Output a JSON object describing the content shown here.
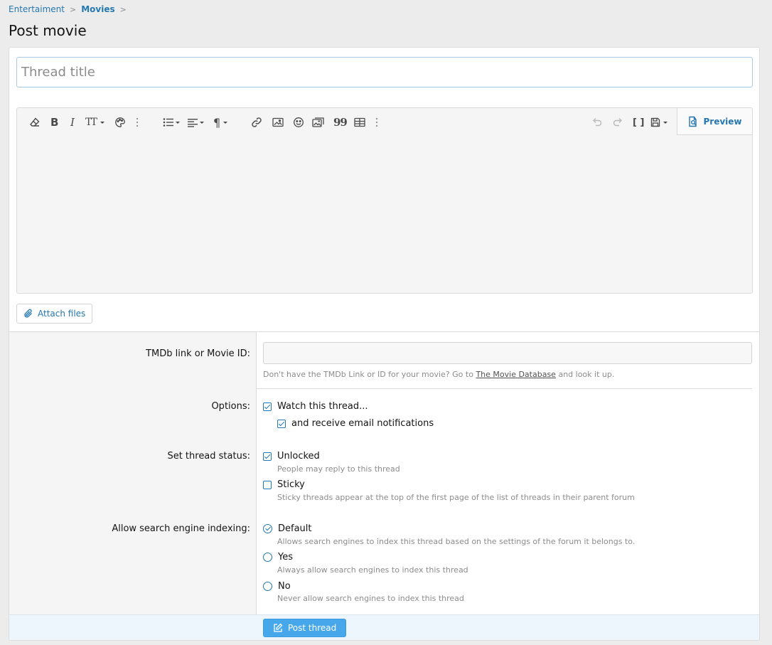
{
  "breadcrumb": {
    "items": [
      {
        "label": "Entertaiment",
        "bold": false
      },
      {
        "label": "Movies",
        "bold": true
      }
    ],
    "separator": ">"
  },
  "page": {
    "title": "Post movie"
  },
  "thread_title": {
    "placeholder": "Thread title",
    "value": ""
  },
  "editor": {
    "toolbar": {
      "icons": [
        "eraser-icon",
        "bold-icon",
        "italic-icon",
        "font-size-icon",
        "color-palette-icon",
        "more-vertical-icon",
        "list-icon",
        "align-icon",
        "paragraph-icon",
        "link-icon",
        "image-icon",
        "smilie-icon",
        "media-icon",
        "quote-icon",
        "table-icon",
        "more-vertical-icon",
        "undo-icon",
        "redo-icon",
        "bbcode-toggle-icon",
        "drafts-icon"
      ],
      "bold_glyph": "B",
      "italic_glyph": "I",
      "font_size_glyph": "TT",
      "paragraph_glyph": "¶",
      "bbcode_glyph": "[ ]",
      "quote_glyph": "99"
    },
    "preview_label": "Preview"
  },
  "attach": {
    "label": "Attach files"
  },
  "form": {
    "tmdb": {
      "label": "TMDb link or Movie ID:",
      "value": "",
      "hint_before": "Don't have the TMDb Link or ID for your movie? Go to",
      "hint_link": "The Movie Database",
      "hint_after": "and look it up."
    },
    "options": {
      "label": "Options:",
      "watch": {
        "label": "Watch this thread...",
        "checked": true
      },
      "email": {
        "label": "and receive email notifications",
        "checked": true
      }
    },
    "status": {
      "label": "Set thread status:",
      "unlocked": {
        "label": "Unlocked",
        "hint": "People may reply to this thread",
        "checked": true
      },
      "sticky": {
        "label": "Sticky",
        "hint": "Sticky threads appear at the top of the first page of the list of threads in their parent forum",
        "checked": false
      }
    },
    "indexing": {
      "label": "Allow search engine indexing:",
      "options": [
        {
          "label": "Default",
          "hint": "Allows search engines to index this thread based on the settings of the forum it belongs to.",
          "checked": true
        },
        {
          "label": "Yes",
          "hint": "Always allow search engines to index this thread",
          "checked": false
        },
        {
          "label": "No",
          "hint": "Never allow search engines to index this thread",
          "checked": false
        }
      ]
    }
  },
  "footer": {
    "submit_label": "Post thread"
  },
  "colors": {
    "accent": "#2577b1",
    "button": "#47a7eb",
    "footer_bg": "#edf6fd"
  }
}
